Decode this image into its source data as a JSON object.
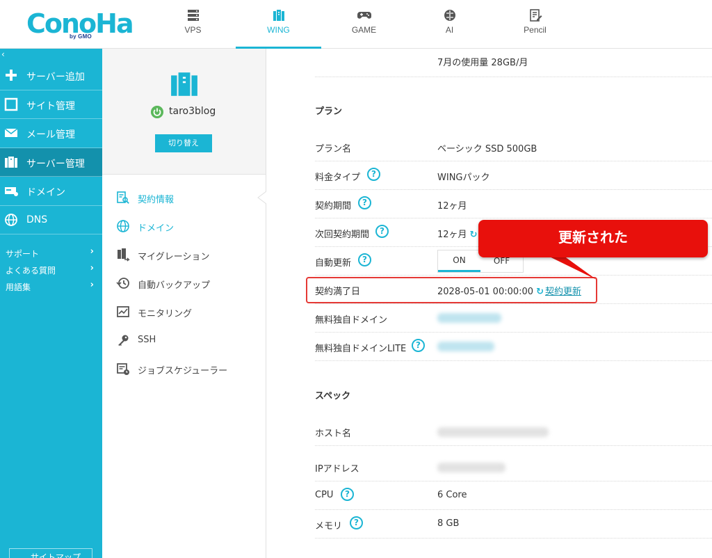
{
  "logo": {
    "text": "ConoHa",
    "sub": "by GMO"
  },
  "nav": [
    {
      "label": "VPS",
      "icon": "server-stack-icon"
    },
    {
      "label": "WING",
      "icon": "wing-server-icon"
    },
    {
      "label": "GAME",
      "icon": "gamepad-icon"
    },
    {
      "label": "AI",
      "icon": "ai-brain-icon"
    },
    {
      "label": "Pencil",
      "icon": "pencil-note-icon"
    }
  ],
  "sidebar": {
    "collapse": "‹",
    "items": [
      {
        "label": "サーバー追加",
        "icon": "plus-icon"
      },
      {
        "label": "サイト管理",
        "icon": "window-icon"
      },
      {
        "label": "メール管理",
        "icon": "mail-icon"
      },
      {
        "label": "サーバー管理",
        "icon": "server-icon"
      },
      {
        "label": "ドメイン",
        "icon": "domain-icon"
      },
      {
        "label": "DNS",
        "icon": "globe-icon"
      }
    ],
    "links": [
      {
        "label": "サポート",
        "chevron": "›"
      },
      {
        "label": "よくある質問",
        "chevron": "›"
      },
      {
        "label": "用語集",
        "chevron": "›"
      }
    ],
    "sitemap": "サイトマップ"
  },
  "server": {
    "name": "taro3blog",
    "switch_label": "切り替え"
  },
  "submenu": [
    {
      "label": "契約情報",
      "icon": "contract-search-icon"
    },
    {
      "label": "ドメイン",
      "icon": "globe-icon"
    },
    {
      "label": "マイグレーション",
      "icon": "migration-icon"
    },
    {
      "label": "自動バックアップ",
      "icon": "backup-clock-icon"
    },
    {
      "label": "モニタリング",
      "icon": "monitoring-chart-icon"
    },
    {
      "label": "SSH",
      "icon": "key-icon"
    },
    {
      "label": "ジョブスケジューラー",
      "icon": "scheduler-icon"
    }
  ],
  "main": {
    "usage": "7月の使用量 28GB/月",
    "plan_section": "プラン",
    "help_glyph": "?",
    "plan": {
      "plan_name": {
        "key": "プラン名",
        "value": "ベーシック SSD 500GB"
      },
      "fee_type": {
        "key": "料金タイプ",
        "value": "WINGパック"
      },
      "period": {
        "key": "契約期間",
        "value": "12ヶ月"
      },
      "next_period": {
        "key": "次回契約期間",
        "value": "12ヶ月"
      },
      "auto_renew": {
        "key": "自動更新",
        "on": "ON",
        "off": "OFF"
      },
      "expiry": {
        "key": "契約満了日",
        "value": "2028-05-01 00:00:00",
        "renew_arrow": "↻",
        "renew_link": "契約更新"
      },
      "free_domain": {
        "key": "無料独自ドメイン"
      },
      "free_domain_lite": {
        "key": "無料独自ドメインLITE"
      }
    },
    "spec_section": "スペック",
    "spec": {
      "host": {
        "key": "ホスト名"
      },
      "ip": {
        "key": "IPアドレス"
      },
      "cpu": {
        "key": "CPU",
        "value": "6 Core"
      },
      "memory": {
        "key": "メモリ",
        "value": "8 GB"
      }
    },
    "callout": "更新された"
  },
  "colors": {
    "brand": "#1bb5d4",
    "sidebar_active": "#1391ac",
    "callout": "#e8100c",
    "power": "#5cb85c"
  }
}
